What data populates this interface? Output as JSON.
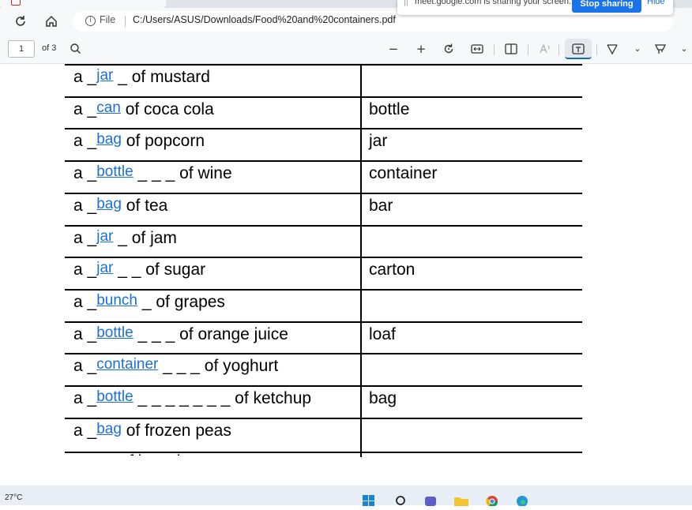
{
  "browser": {
    "file_label": "File",
    "url": "C:/Users/ASUS/Downloads/Food%20and%20containers.pdf"
  },
  "share_banner": {
    "message": "meet.google.com is sharing your screen.",
    "stop_label": "Stop sharing",
    "hide_label": "Hide"
  },
  "pdf_toolbar": {
    "page_number": "1",
    "page_total": "of 3"
  },
  "worksheet": {
    "rows": [
      {
        "article": "a",
        "answer": "jar",
        "blank_trail": "_",
        "phrase": "of mustard",
        "container": ""
      },
      {
        "article": "a",
        "answer": "can",
        "blank_trail": "",
        "phrase": "of coca cola",
        "container": "bottle"
      },
      {
        "article": "a",
        "answer": "bag",
        "blank_trail": "",
        "phrase": "of popcorn",
        "container": "jar"
      },
      {
        "article": "a",
        "answer": "bottle",
        "blank_trail": "_ _ _",
        "phrase": "of wine",
        "container": "container"
      },
      {
        "article": "a",
        "answer": "bag",
        "blank_trail": "",
        "phrase": "of tea",
        "container": "bar"
      },
      {
        "article": "a",
        "answer": "jar",
        "blank_trail": "_",
        "phrase": "of jam",
        "container": ""
      },
      {
        "article": "a",
        "answer": "jar",
        "blank_trail": "_ _",
        "phrase": "of sugar",
        "container": "carton"
      },
      {
        "article": "a",
        "answer": "bunch",
        "blank_trail": "_",
        "phrase": "of grapes",
        "container": ""
      },
      {
        "article": "a",
        "answer": "bottle",
        "blank_trail": "_ _ _",
        "phrase": "of orange juice",
        "container": "loaf"
      },
      {
        "article": "a",
        "answer": "container",
        "blank_trail": "_ _ _",
        "phrase": "of yoghurt",
        "container": ""
      },
      {
        "article": "a",
        "answer": "bottle",
        "blank_trail": "_ _ _ _ _ _ _",
        "phrase": "of ketchup",
        "container": "bag"
      },
      {
        "article": "a",
        "answer": "bag",
        "blank_trail": "",
        "phrase": "of frozen peas",
        "container": ""
      }
    ]
  },
  "taskbar": {
    "temperature": "27°C"
  },
  "colors": {
    "answer_ink": "#1a6fd8",
    "stop_button": "#1a73e8",
    "toolbar_active": "#0f6cbd"
  },
  "icons": {
    "toolbar": [
      "search-icon",
      "zoom-out-icon",
      "zoom-in-icon",
      "rotate-icon",
      "fit-width-icon",
      "page-view-icon",
      "read-aloud-icon",
      "text-icon",
      "draw-icon",
      "highlight-icon"
    ]
  }
}
